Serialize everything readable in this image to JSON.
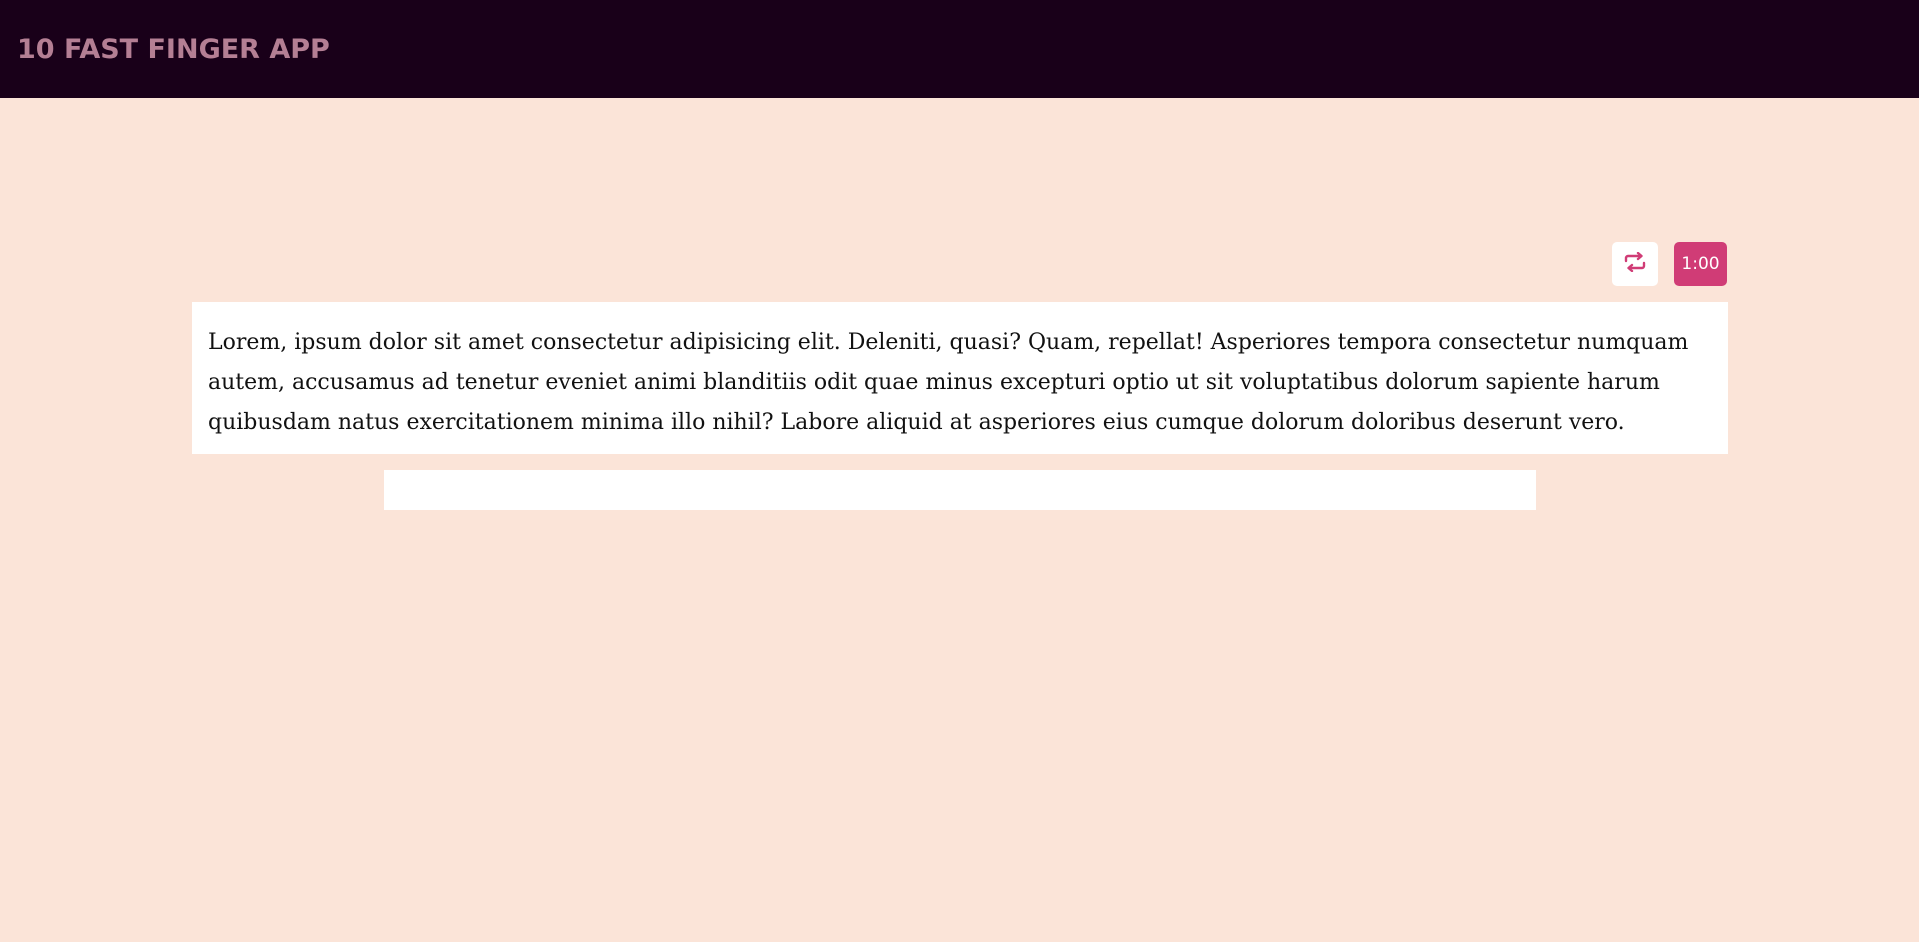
{
  "app": {
    "title": "10 FAST FINGER APP"
  },
  "controls": {
    "reset_icon": "repeat-icon",
    "timer": "1:00"
  },
  "passage": {
    "text": "Lorem, ipsum dolor sit amet consectetur adipisicing elit. Deleniti, quasi? Quam, repellat! Asperiores tempora consectetur numquam autem, accusamus ad tenetur eveniet animi blanditiis odit quae minus excepturi optio ut sit voluptatibus dolorum sapiente harum quibusdam natus exercitationem minima illo nihil? Labore aliquid at asperiores eius cumque dolorum doloribus deserunt vero."
  },
  "input": {
    "value": "",
    "placeholder": ""
  },
  "colors": {
    "navbar": "#190019",
    "brand_text": "#b47f94",
    "background": "#fbe4d8",
    "accent": "#d03c76"
  }
}
